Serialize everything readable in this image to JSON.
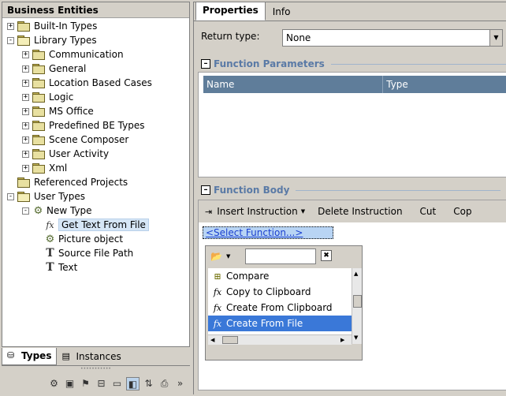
{
  "left": {
    "title": "Business Entities",
    "tree": [
      {
        "label": "Built-In Types",
        "level": 0,
        "exp": "+",
        "icon": "folder"
      },
      {
        "label": "Library Types",
        "level": 0,
        "exp": "-",
        "icon": "folder-open"
      },
      {
        "label": "Communication",
        "level": 1,
        "exp": "+",
        "icon": "folder"
      },
      {
        "label": "General",
        "level": 1,
        "exp": "+",
        "icon": "folder"
      },
      {
        "label": "Location Based Cases",
        "level": 1,
        "exp": "+",
        "icon": "folder"
      },
      {
        "label": "Logic",
        "level": 1,
        "exp": "+",
        "icon": "folder"
      },
      {
        "label": "MS Office",
        "level": 1,
        "exp": "+",
        "icon": "folder"
      },
      {
        "label": "Predefined BE Types",
        "level": 1,
        "exp": "+",
        "icon": "folder"
      },
      {
        "label": "Scene Composer",
        "level": 1,
        "exp": "+",
        "icon": "folder"
      },
      {
        "label": "User Activity",
        "level": 1,
        "exp": "+",
        "icon": "folder"
      },
      {
        "label": "Xml",
        "level": 1,
        "exp": "+",
        "icon": "folder"
      },
      {
        "label": "Referenced Projects",
        "level": 0,
        "exp": "",
        "icon": "folder"
      },
      {
        "label": "User Types",
        "level": 0,
        "exp": "-",
        "icon": "folder-open"
      },
      {
        "label": "New Type",
        "level": 1,
        "exp": "-",
        "icon": "entity"
      },
      {
        "label": "Get Text From File",
        "level": 2,
        "exp": "",
        "icon": "function",
        "selected": true
      },
      {
        "label": "Picture object",
        "level": 2,
        "exp": "",
        "icon": "entity"
      },
      {
        "label": "Source File Path",
        "level": 2,
        "exp": "",
        "icon": "text-attr"
      },
      {
        "label": "Text",
        "level": 2,
        "exp": "",
        "icon": "text-attr"
      }
    ],
    "tabs": {
      "types": "Types",
      "instances": "Instances"
    },
    "bottom_icons": [
      "entity-icon",
      "documents-icon",
      "flag-icon",
      "tray-icon",
      "monitor-icon",
      "box-icon",
      "transfer-icon",
      "printer-icon",
      "more-icon"
    ]
  },
  "right": {
    "tabs": {
      "properties": "Properties",
      "info": "Info"
    },
    "return_type_label": "Return type:",
    "return_type_value": "None",
    "params_title": "Function Parameters",
    "params_columns": {
      "name": "Name",
      "type": "Type"
    },
    "body_title": "Function Body",
    "toolbar": {
      "insert": "Insert Instruction",
      "delete": "Delete Instruction",
      "cut": "Cut",
      "copy": "Cop"
    },
    "select_function": "<Select Function...>",
    "popup_items": [
      {
        "label": "Compare",
        "icon": "compare-icon"
      },
      {
        "label": "Copy to Clipboard",
        "icon": "function-icon"
      },
      {
        "label": "Create From Clipboard",
        "icon": "function-icon"
      },
      {
        "label": "Create From File",
        "icon": "function-icon",
        "selected": true
      }
    ]
  }
}
